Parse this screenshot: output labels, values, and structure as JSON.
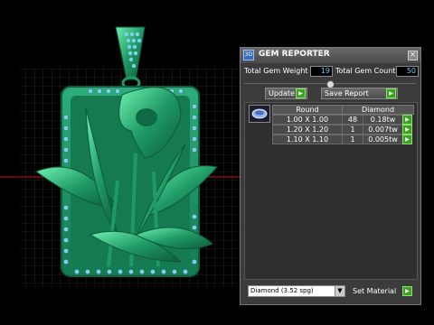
{
  "panel": {
    "title": "GEM REPORTER",
    "app_icon_label": "3D",
    "close_glyph": "×",
    "total_weight_label": "Total Gem Weight",
    "total_weight_value": "19",
    "total_count_label": "Total Gem Count",
    "total_count_value": "50",
    "update_label": "Update",
    "save_report_label": "Save Report",
    "arrow_glyph": "▶",
    "table": {
      "headers": [
        "Round",
        "Diamond"
      ],
      "rows": [
        {
          "size": "1.00 X 1.00",
          "count": "48",
          "weight": "0.18tw"
        },
        {
          "size": "1.20 X 1.20",
          "count": "1",
          "weight": "0.007tw"
        },
        {
          "size": "1.10 X 1.10",
          "count": "1",
          "weight": "0.005tw"
        }
      ]
    },
    "material_select": "Diamond    (3.52 spg)",
    "dropdown_glyph": "▼",
    "set_material_label": "Set Material"
  },
  "colors": {
    "accent_value": "#5fd0ff",
    "button_green": "#3ea020",
    "gem_green": "#2fae7a",
    "gem_blue": "#7fd0e8",
    "axis_red": "#d01010"
  },
  "icons": [
    "gem-thumbnail-icon",
    "close-icon",
    "green-arrow-icon",
    "dropdown-arrow-icon",
    "app-icon"
  ]
}
